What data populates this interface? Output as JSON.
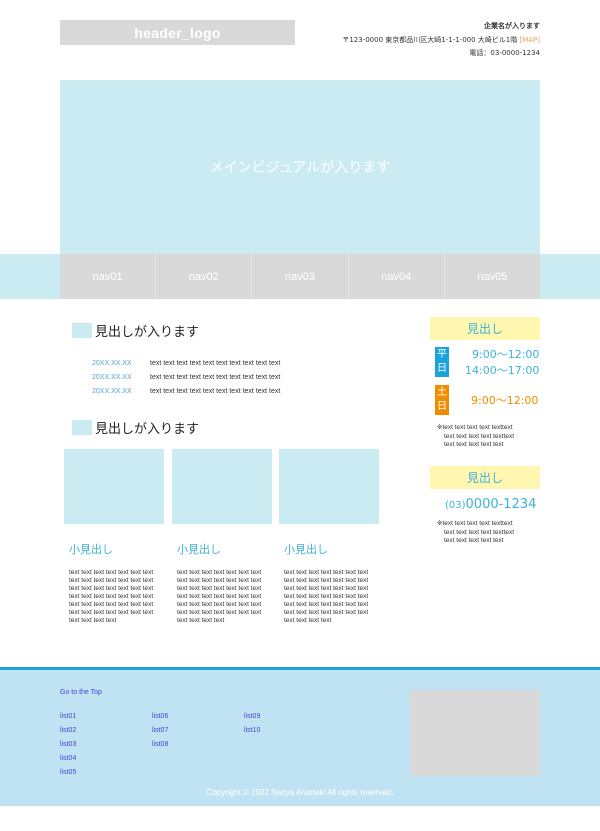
{
  "header": {
    "logo": "header_logo",
    "company_name": "企業名が入ります",
    "address": "〒123-0000 東京都品川区大崎1-1-1-000 大崎ビル1階",
    "map_link": "[MAP]",
    "phone": "電話：03-0000-1234"
  },
  "main_visual": {
    "text": "メインビジュアルが入ります"
  },
  "nav": {
    "items": [
      "nav01",
      "nav02",
      "nav03",
      "nav04",
      "nav05"
    ]
  },
  "news": {
    "heading": "見出しが入ります",
    "items": [
      {
        "date": "20XX.XX.XX",
        "text": "text text text text text text text text text text"
      },
      {
        "date": "20XX.XX.XX",
        "text": "text text text text text text text text text text"
      },
      {
        "date": "20XX.XX.XX",
        "text": "text text text text text text text text text text"
      }
    ]
  },
  "features": {
    "heading": "見出しが入ります",
    "cards": [
      {
        "title": "小見出し",
        "body": "text text text text text text text text text text text text text text text text text text text text text text text text text text text text text text text text text text text text text text text text text text text text text text"
      },
      {
        "title": "小見出し",
        "body": "text text text text text text text text text text text text text text text text text text text text text text text text text text text text text text text text text text text text text text text text text text text text text text"
      },
      {
        "title": "小見出し",
        "body": "text text text text text text text text text text text text text text text text text text text text text text text text text text text text text text text text text text text text text text text text text text text text text text"
      }
    ]
  },
  "sidebar": {
    "hours_heading": "見出し",
    "weekday_tag": "平日",
    "weekday_times": [
      "9:00〜12:00",
      "14:00〜17:00"
    ],
    "weekend_tag": "土日",
    "weekend_times": [
      "9:00〜12:00"
    ],
    "hours_note": [
      "※text text text text texttext",
      "text text text text texttext",
      "text text text text text"
    ],
    "contact_heading": "見出し",
    "tel_area": "(03)",
    "tel_number": "0000-1234",
    "contact_note": [
      "※text text text text texttext",
      "text text text text texttext",
      "text text text text text"
    ]
  },
  "footer": {
    "top_link": "Go to the Top",
    "col1": [
      "list01",
      "list02",
      "list03",
      "list04",
      "list05"
    ],
    "col2": [
      "list06",
      "list07",
      "list08"
    ],
    "col3": [
      "list09",
      "list10"
    ],
    "copyright": "Copyright © 2022 Naoya Aramaki All rights reserved."
  },
  "colors": {
    "accent_blue": "#3fb2dd",
    "light_blue": "#cbebf3",
    "weekday_tag": "#1aa3dc",
    "weekend_tag": "#f08c00",
    "box_yellow": "#fff6b0",
    "footer_bg": "#bfe3f3"
  }
}
